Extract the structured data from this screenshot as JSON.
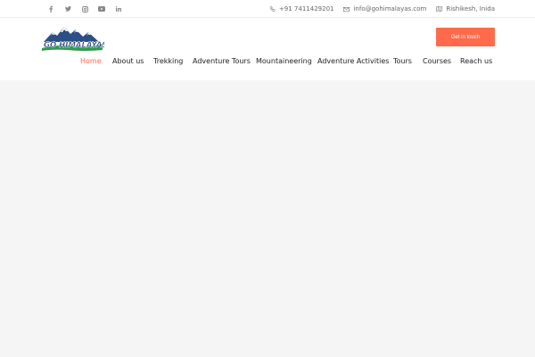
{
  "topbar": {
    "social": [
      {
        "icon": "facebook-icon"
      },
      {
        "icon": "twitter-icon"
      },
      {
        "icon": "instagram-icon"
      },
      {
        "icon": "youtube-icon"
      },
      {
        "icon": "linkedin-icon"
      }
    ],
    "phone": "+91 7411429201",
    "email": "info@gohimalayas.com",
    "location": "Rishikesh, Inida"
  },
  "header": {
    "logo_text": "GO HIMALAYAS",
    "cta_label": "Get in touch"
  },
  "nav": {
    "items": [
      {
        "label": "Home",
        "active": true
      },
      {
        "label": "About us"
      },
      {
        "label": "Trekking"
      },
      {
        "label": "Adventure Tours"
      },
      {
        "label": "Mountaineering"
      },
      {
        "label": "Adventure Activities"
      },
      {
        "label": "Tours"
      },
      {
        "label": "Courses"
      },
      {
        "label": "Reach us"
      }
    ]
  },
  "colors": {
    "accent": "#ff6b4a",
    "logo_blue": "#1f4b8f",
    "logo_green": "#2e9b4b"
  }
}
